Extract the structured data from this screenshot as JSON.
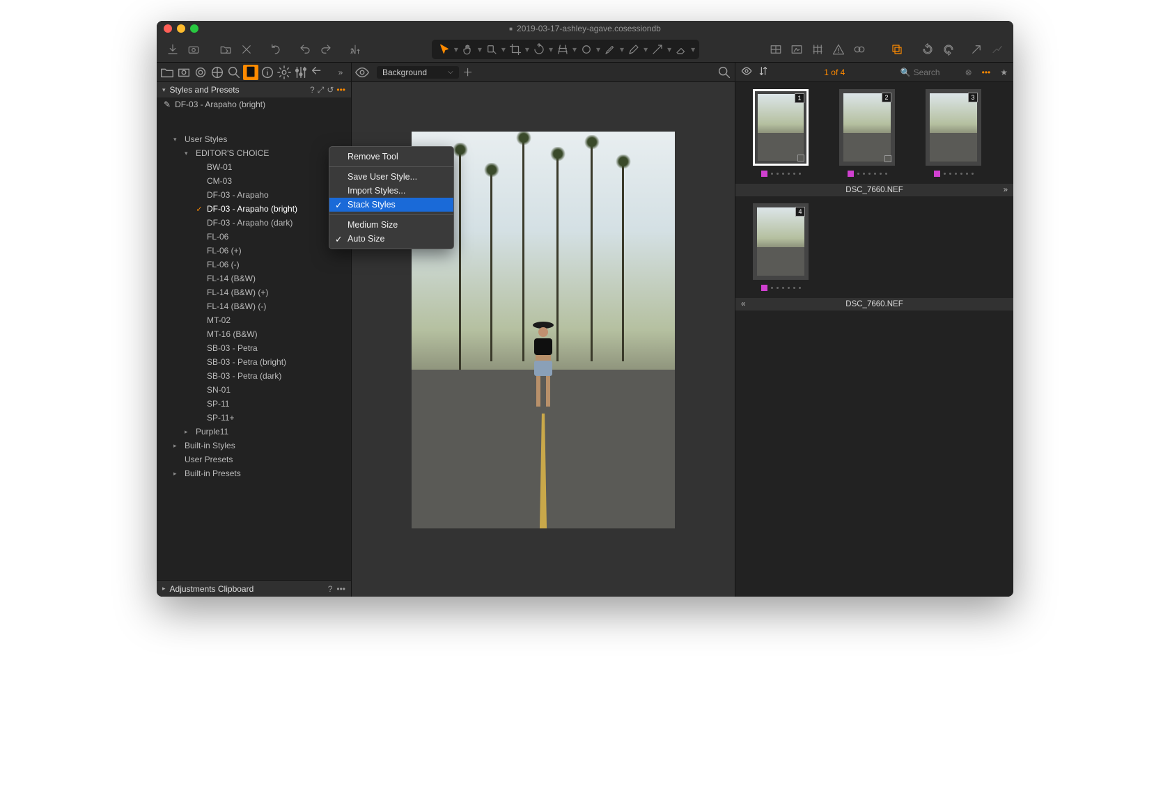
{
  "title": "2019-03-17-ashley-agave.cosessiondb",
  "viewer": {
    "bg_label": "Background"
  },
  "left": {
    "styles_presets_hdr": "Styles and Presets",
    "applied": "DF-03 - Arapaho (bright)",
    "user_styles_hdr": "User Styles",
    "editors_choice_hdr": "EDITOR'S CHOICE",
    "styles": [
      "BW-01",
      "CM-03",
      "DF-03 - Arapaho",
      "DF-03 - Arapaho (bright)",
      "DF-03 - Arapaho (dark)",
      "FL-06",
      "FL-06 (+)",
      "FL-06 (-)",
      "FL-14 (B&W)",
      "FL-14 (B&W) (+)",
      "FL-14 (B&W) (-)",
      "MT-02",
      "MT-16 (B&W)",
      "SB-03 - Petra",
      "SB-03 - Petra (bright)",
      "SB-03 - Petra (dark)",
      "SN-01",
      "SP-11",
      "SP-11+"
    ],
    "selected_index": 3,
    "purple11": "Purple11",
    "builtin_styles": "Built-in Styles",
    "user_presets": "User Presets",
    "builtin_presets": "Built-in Presets",
    "clipboard": "Adjustments Clipboard"
  },
  "ctx": {
    "remove_tool": "Remove Tool",
    "save_user": "Save User Style...",
    "import_styles": "Import Styles...",
    "stack_styles": "Stack Styles",
    "medium_size": "Medium Size",
    "auto_size": "Auto Size"
  },
  "browser": {
    "count": "1 of 4",
    "search_placeholder": "Search",
    "filename1": "DSC_7660.NEF",
    "filename2": "DSC_7660.NEF",
    "badges": [
      "1",
      "2",
      "3",
      "4"
    ]
  }
}
